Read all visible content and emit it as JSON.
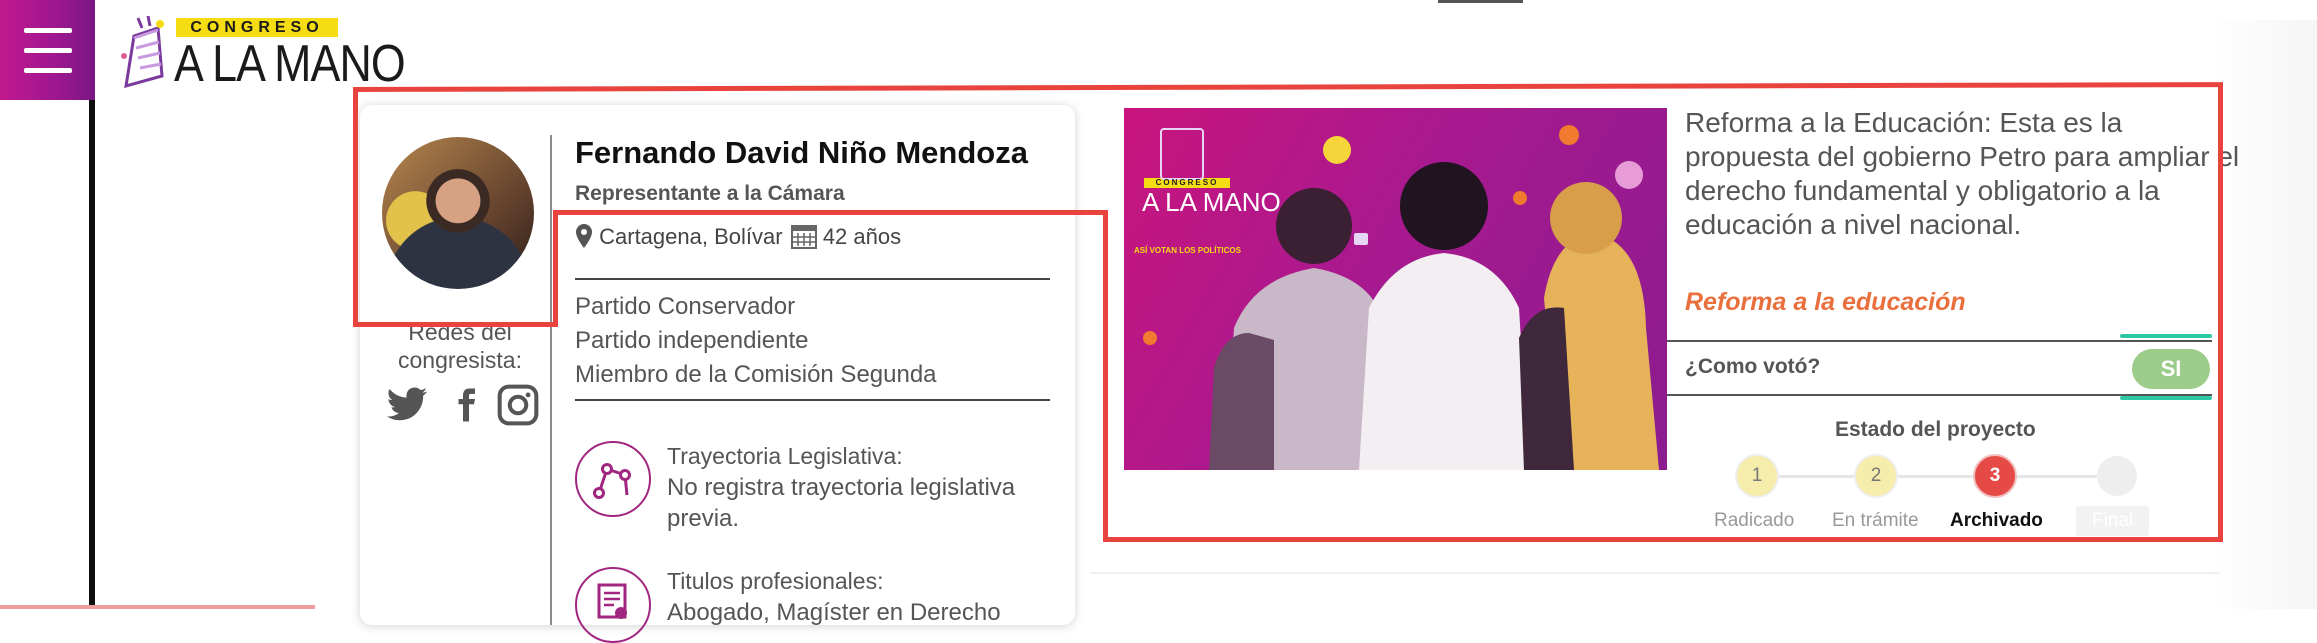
{
  "header": {
    "logo_top": "CONGRESO",
    "logo_main": "A LA MANO"
  },
  "congresista": {
    "name": "Fernando David Niño Mendoza",
    "role": "Representante a la Cámara",
    "location": "Cartagena, Bolívar",
    "age": "42 años",
    "parties": [
      "Partido Conservador",
      "Partido independiente",
      "Miembro de la Comisión Segunda"
    ],
    "redes_label": "Redes del congresista:",
    "social_icons": [
      "twitter-icon",
      "facebook-icon",
      "instagram-icon"
    ],
    "sections": [
      {
        "title": "Trayectoria Legislativa:",
        "body": "No registra trayectoria legislativa previa."
      },
      {
        "title": "Titulos profesionales:",
        "body": "Abogado, Magíster en Derecho"
      }
    ]
  },
  "proyecto": {
    "image_logo_top": "CONGRESO",
    "image_logo_main": "A LA MANO",
    "image_logo_sub": "ASÍ VOTAN LOS POLÍTICOS",
    "description": "Reforma a la Educación: Esta es la propuesta del gobierno Petro para ampliar el derecho fundamental y obligatorio a la educación a nivel nacional.",
    "link": "Reforma a la educación",
    "voto_label": "¿Como votó?",
    "voto_value": "SI",
    "estado_title": "Estado del proyecto",
    "steps": [
      {
        "num": "1",
        "label": "Radicado"
      },
      {
        "num": "2",
        "label": "En trámite"
      },
      {
        "num": "3",
        "label": "Archivado"
      },
      {
        "num": "",
        "label": "Final"
      }
    ],
    "active_step": 3
  },
  "colors": {
    "brand_magenta": "#a01791",
    "logo_yellow": "#f6dc12",
    "link_orange": "#e9703d",
    "vote_green": "#9ccc8a",
    "step_active": "#e54a46",
    "annotation_red": "#e8433d"
  }
}
